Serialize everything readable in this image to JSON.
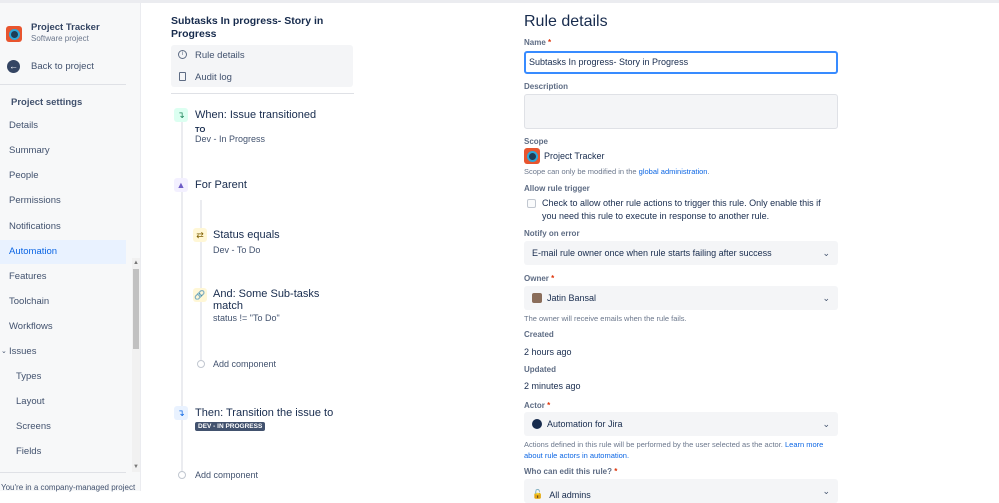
{
  "sidebar": {
    "project_name": "Project Tracker",
    "project_type": "Software project",
    "back": "Back to project",
    "section": "Project settings",
    "items": [
      "Details",
      "Summary",
      "People",
      "Permissions",
      "Notifications",
      "Automation",
      "Features",
      "Toolchain",
      "Workflows",
      "Issues"
    ],
    "sub_items": [
      "Types",
      "Layout",
      "Screens",
      "Fields"
    ],
    "footer": "You're in a company-managed project"
  },
  "rule": {
    "title": "Subtasks In progress- Story in Progress",
    "menu": [
      "Rule details",
      "Audit log"
    ],
    "trigger": {
      "title": "When: Issue transitioned",
      "label": "TO",
      "value": "Dev - In Progress"
    },
    "branch": "For Parent",
    "condition1": {
      "title": "Status equals",
      "value": "Dev - To Do"
    },
    "condition2": {
      "title": "And: Some Sub-tasks match",
      "value": "status != \"To Do\""
    },
    "add_component": "Add component",
    "action": {
      "title": "Then: Transition the issue to",
      "badge": "DEV - IN PROGRESS"
    }
  },
  "details": {
    "heading": "Rule details",
    "name_label": "Name",
    "name_value": "Subtasks In progress- Story in Progress",
    "description_label": "Description",
    "description_value": "",
    "scope_label": "Scope",
    "scope_value": "Project Tracker",
    "scope_help": "Scope can only be modified in the ",
    "scope_link": "global administration",
    "scope_end": ".",
    "allow_label": "Allow rule trigger",
    "allow_text": "Check to allow other rule actions to trigger this rule. Only enable this if you need this rule to execute in response to another rule.",
    "notify_label": "Notify on error",
    "notify_value": "E-mail rule owner once when rule starts failing after success",
    "owner_label": "Owner",
    "owner_value": "Jatin Bansal",
    "owner_help": "The owner will receive emails when the rule fails.",
    "created_label": "Created",
    "created_value": "2 hours ago",
    "updated_label": "Updated",
    "updated_value": "2 minutes ago",
    "actor_label": "Actor",
    "actor_value": "Automation for Jira",
    "actor_help": "Actions defined in this rule will be performed by the user selected as the actor. ",
    "actor_link": "Learn more about rule actors in automation.",
    "edit_label": "Who can edit this rule?",
    "edit_value": "All admins"
  },
  "colors": {
    "accent": "#0c66e4",
    "selected_bg": "#e9f2ff",
    "badge": "#42526e"
  }
}
